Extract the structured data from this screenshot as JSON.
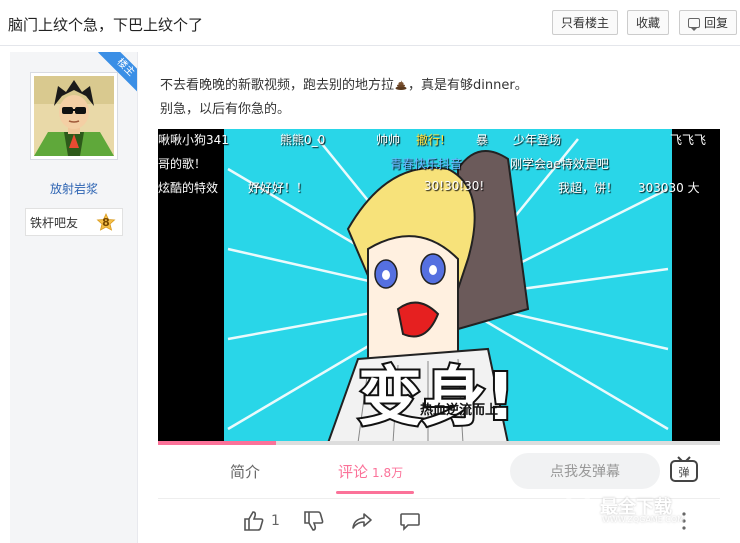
{
  "header": {
    "title": "脑门上纹个急，下巴上纹个了",
    "only_op_label": "只看楼主",
    "favorite_label": "收藏",
    "reply_label": "回复"
  },
  "author": {
    "corner_tag": "楼主",
    "name": "放射岩浆",
    "badge_label": "铁杆吧友",
    "level": "8"
  },
  "content": {
    "line1_before": "不去看晚晚的新歌视频，跑去别的地方拉",
    "line1_after": "，真是有够dinner。",
    "line2": "别急，以后有你急的。"
  },
  "screenshot": {
    "danmaku": [
      "啾啾小狗341",
      "熊熊0_0",
      "帅帅",
      "撤行!",
      "暴",
      "少年登场",
      "飞飞飞",
      "哥的歌！",
      "青春快乐抖音",
      "刚学会ae特效是吧",
      "炫酷的特效",
      "好好好！！",
      "30!30!30!",
      "我超，饼！",
      "303030 大"
    ],
    "video_text": {
      "transform": "变身!",
      "subtitle_line": "热血逆流而上",
      "pinyin": [
        "re",
        "xue",
        "ni",
        "liu",
        "er",
        "shang"
      ]
    },
    "progress": 0.21,
    "tabs": [
      {
        "label": "简介"
      },
      {
        "label": "评论",
        "count": "1.8万"
      }
    ],
    "danmaku_placeholder": "点我发弹幕",
    "danmaku_toggle_label": "弹",
    "like_count": "1",
    "watermark": "最全下载",
    "watermark_sub": "WWW.ZQGAME.COM"
  },
  "colors": {
    "accent_pink": "#fb7299",
    "link_blue": "#2d64b3",
    "ribbon_blue": "#3b8fe6",
    "video_bg": "#29d6e8"
  },
  "icons": [
    "reply-icon",
    "level-badge-icon",
    "poop-icon",
    "like-icon",
    "dislike-icon",
    "share-icon",
    "comment-icon",
    "more-icon",
    "danmaku-toggle-icon"
  ]
}
